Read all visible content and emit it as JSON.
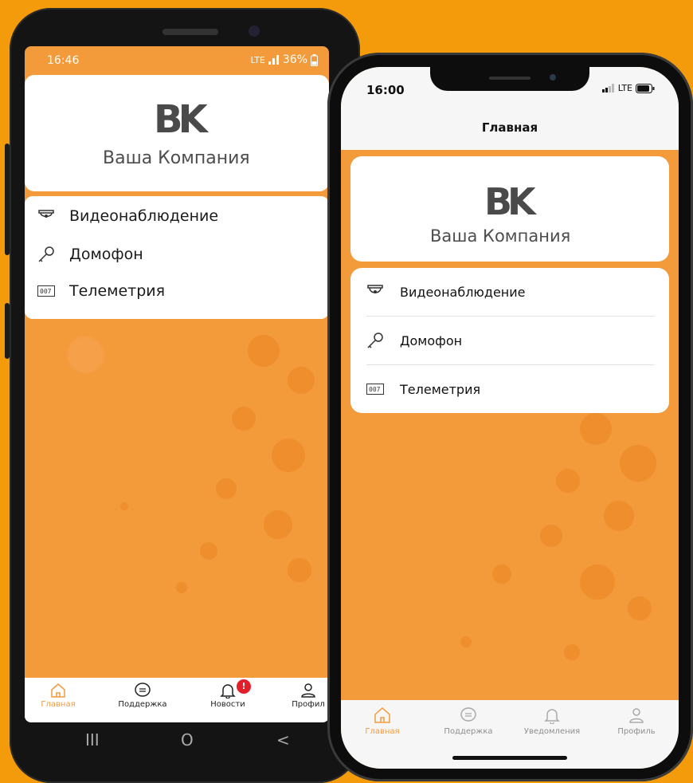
{
  "android": {
    "status": {
      "time": "16:46",
      "network": "LTE",
      "battery": "36%"
    },
    "company_logo": {
      "mark": "BK",
      "name": "Ваша Компания"
    },
    "menu": [
      {
        "label": "Видеонаблюдение",
        "icon": "camera-icon"
      },
      {
        "label": "Домофон",
        "icon": "key-icon"
      },
      {
        "label": "Телеметрия",
        "icon": "meter-icon"
      }
    ],
    "tabs": [
      {
        "label": "Главная",
        "icon": "home-icon",
        "active": true
      },
      {
        "label": "Поддержка",
        "icon": "chat-icon"
      },
      {
        "label": "Новости",
        "icon": "bell-icon",
        "badge": "!"
      },
      {
        "label": "Профил",
        "icon": "user-icon"
      }
    ],
    "nav": {
      "recent": "III",
      "home": "O",
      "back": "<"
    }
  },
  "iphone": {
    "status": {
      "time": "16:00",
      "network": "LTE"
    },
    "title": "Главная",
    "company_logo": {
      "mark": "BK",
      "name": "Ваша Компания"
    },
    "menu": [
      {
        "label": "Видеонаблюдение",
        "icon": "camera-icon"
      },
      {
        "label": "Домофон",
        "icon": "key-icon"
      },
      {
        "label": "Телеметрия",
        "icon": "meter-icon"
      }
    ],
    "tabs": [
      {
        "label": "Главная",
        "icon": "home-icon",
        "active": true
      },
      {
        "label": "Поддержка",
        "icon": "chat-icon"
      },
      {
        "label": "Уведомления",
        "icon": "bell-icon"
      },
      {
        "label": "Профиль",
        "icon": "user-icon"
      }
    ]
  },
  "colors": {
    "background": "#f49b0b",
    "accent": "#f39a3b",
    "badge": "#e31f2a"
  }
}
